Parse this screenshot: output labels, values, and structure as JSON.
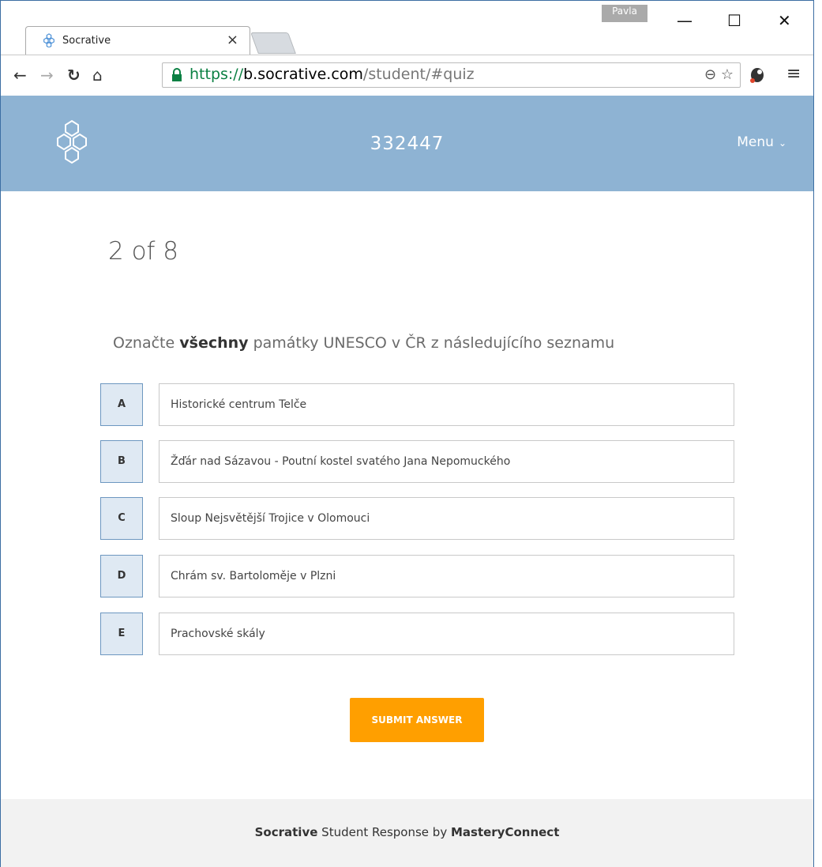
{
  "browser": {
    "profile_name": "Pavla",
    "tab_title": "Socrative",
    "tab_close": "×",
    "url_scheme": "https://",
    "url_host": "b.socrative.com",
    "url_path": "/student/#quiz",
    "window_controls": {
      "minimize": "—",
      "maximize": "☐",
      "close": "✕"
    }
  },
  "header": {
    "room_name": "332447",
    "menu_label": "Menu",
    "menu_chevron": "⌄",
    "bg_color": "#8eb3d3"
  },
  "quiz": {
    "progress": "2 of 8",
    "question_prefix": "Označte ",
    "question_bold": "všechny",
    "question_suffix": " památky UNESCO v ČR z následujícího seznamu",
    "options": [
      {
        "letter": "A",
        "text": "Historické centrum Telče"
      },
      {
        "letter": "B",
        "text": "Žďár nad Sázavou - Poutní kostel svatého Jana Nepomuckého"
      },
      {
        "letter": "C",
        "text": "Sloup Nejsvětější Trojice v Olomouci"
      },
      {
        "letter": "D",
        "text": "Chrám sv. Bartoloměje v Plzni"
      },
      {
        "letter": "E",
        "text": "Prachovské skály"
      }
    ],
    "submit_label": "SUBMIT ANSWER",
    "submit_color": "#ff9f00"
  },
  "footer": {
    "brand": "Socrative",
    "middle": " Student Response by ",
    "company": "MasteryConnect"
  }
}
